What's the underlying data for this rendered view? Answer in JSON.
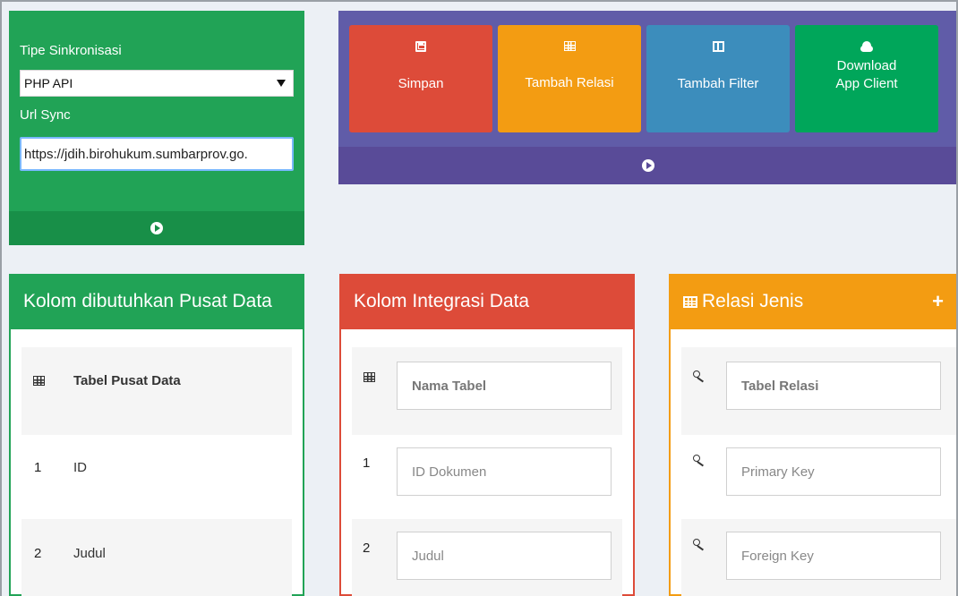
{
  "sync": {
    "type_label": "Tipe Sinkronisasi",
    "type_value": "PHP API",
    "url_label": "Url Sync",
    "url_value": "https://jdih.birohukum.sumbarprov.go."
  },
  "actions": [
    {
      "label": "Simpan",
      "icon": "save-icon",
      "color": "#dd4b39"
    },
    {
      "label": "Tambah Relasi",
      "icon": "table-icon",
      "color": "#f39c12"
    },
    {
      "label": "Tambah Filter",
      "icon": "columns-icon",
      "color": "#3c8dbc"
    },
    {
      "label_line1": "Download",
      "label_line2": "App Client",
      "icon": "cloud-download-icon",
      "color": "#00a65a"
    }
  ],
  "panels": {
    "pusat": {
      "title": "Kolom dibutuhkan Pusat Data",
      "header_cell": "Tabel Pusat Data",
      "rows": [
        {
          "num": "1",
          "value": "ID"
        },
        {
          "num": "2",
          "value": "Judul"
        }
      ]
    },
    "integrasi": {
      "title": "Kolom Integrasi Data",
      "header_field": "Nama Tabel",
      "rows": [
        {
          "num": "1",
          "value": "ID Dokumen"
        },
        {
          "num": "2",
          "value": "Judul"
        }
      ]
    },
    "relasi": {
      "title": "Relasi Jenis",
      "add": "+",
      "fields": [
        "Tabel Relasi",
        "Primary Key",
        "Foreign Key"
      ]
    }
  },
  "colors": {
    "green": "#21a356",
    "purple": "#605ca8",
    "red": "#dd4b39",
    "orange": "#f39c12",
    "blue": "#3c8dbc"
  }
}
